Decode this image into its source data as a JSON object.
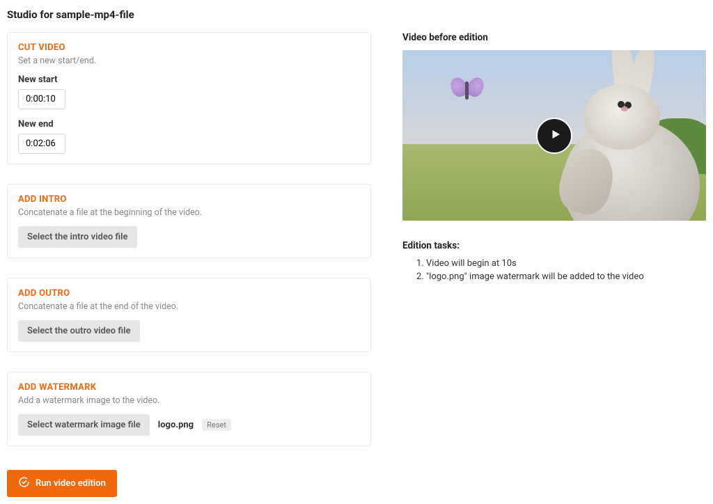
{
  "page_title": "Studio for sample-mp4-file",
  "cut": {
    "title": "CUT VIDEO",
    "desc": "Set a new start/end.",
    "start_label": "New start",
    "start_value": "0:00:10",
    "end_label": "New end",
    "end_value": "0:02:06"
  },
  "intro": {
    "title": "ADD INTRO",
    "desc": "Concatenate a file at the beginning of the video.",
    "select_label": "Select the intro video file"
  },
  "outro": {
    "title": "ADD OUTRO",
    "desc": "Concatenate a file at the end of the video.",
    "select_label": "Select the outro video file"
  },
  "watermark": {
    "title": "ADD WATERMARK",
    "desc": "Add a watermark image to the video.",
    "select_label": "Select watermark image file",
    "file_name": "logo.png",
    "reset_label": "Reset"
  },
  "run_label": "Run video edition",
  "preview": {
    "title": "Video before edition"
  },
  "tasks": {
    "title": "Edition tasks:",
    "items": [
      "Video will begin at 10s",
      "\"logo.png\" image watermark will be added to the video"
    ]
  }
}
